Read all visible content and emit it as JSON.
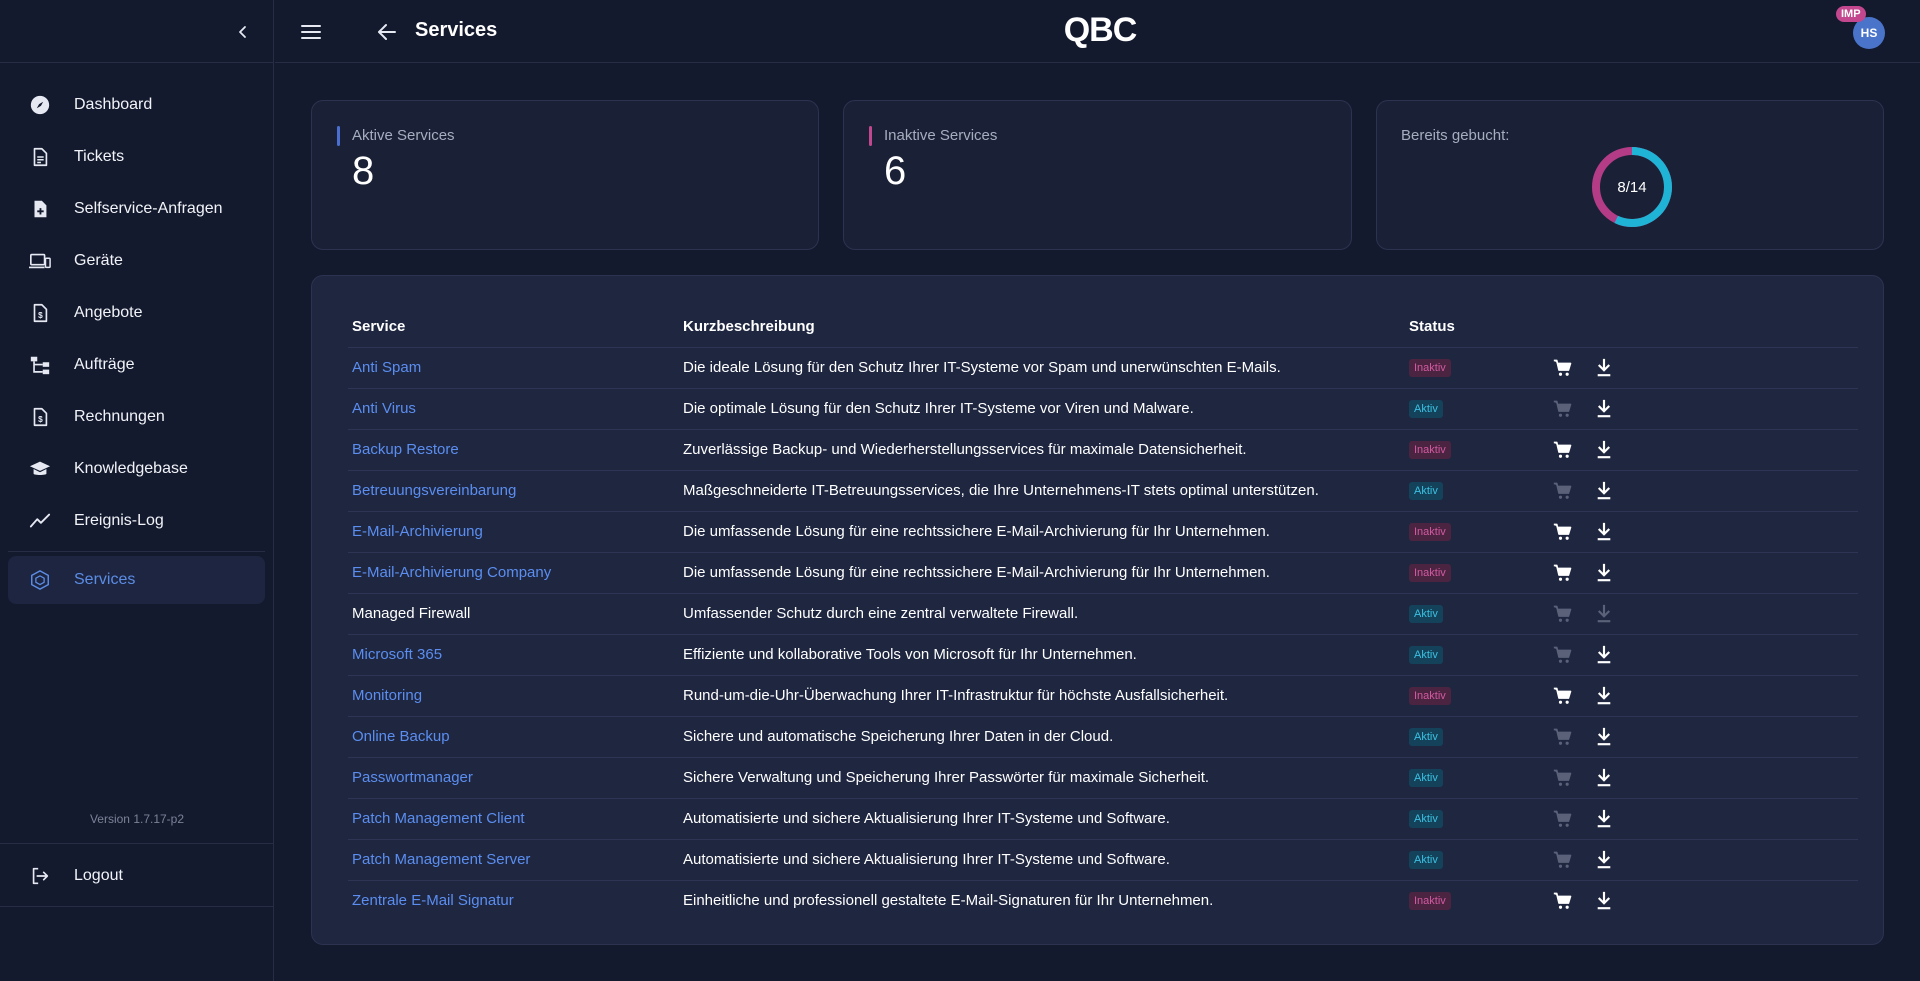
{
  "app": {
    "page_title": "Services",
    "logo_text": "QBC",
    "avatar_initials": "HS",
    "imp_badge": "IMP"
  },
  "sidebar": {
    "items": [
      {
        "id": "dashboard",
        "label": "Dashboard",
        "icon": "compass-icon"
      },
      {
        "id": "tickets",
        "label": "Tickets",
        "icon": "document-icon"
      },
      {
        "id": "selfservice",
        "label": "Selfservice-Anfragen",
        "icon": "file-plus-icon"
      },
      {
        "id": "geraete",
        "label": "Geräte",
        "icon": "devices-icon"
      },
      {
        "id": "angebote",
        "label": "Angebote",
        "icon": "invoice-icon"
      },
      {
        "id": "auftraege",
        "label": "Aufträge",
        "icon": "sitemap-icon"
      },
      {
        "id": "rechnungen",
        "label": "Rechnungen",
        "icon": "invoice-icon"
      },
      {
        "id": "knowledgebase",
        "label": "Knowledgebase",
        "icon": "graduation-cap-icon"
      },
      {
        "id": "ereignis",
        "label": "Ereignis-Log",
        "icon": "chart-line-icon"
      }
    ],
    "active": {
      "id": "services",
      "label": "Services",
      "icon": "cube-icon"
    },
    "version": "Version 1.7.17-p2",
    "logout": "Logout"
  },
  "stats": {
    "active_label": "Aktive Services",
    "active_value": "8",
    "inactive_label": "Inaktive Services",
    "inactive_value": "6",
    "booked_label": "Bereits gebucht:",
    "booked_text": "8/14",
    "booked_fraction": 0.5714
  },
  "table": {
    "headers": {
      "service": "Service",
      "description": "Kurzbeschreibung",
      "status": "Status"
    },
    "rows": [
      {
        "name": "Anti Spam",
        "description": "Die ideale Lösung für den Schutz Ihrer IT-Systeme vor Spam und unerwünschten E-Mails.",
        "status": "Inaktiv",
        "link": true,
        "cart": true,
        "download": true
      },
      {
        "name": "Anti Virus",
        "description": "Die optimale Lösung für den Schutz Ihrer IT-Systeme vor Viren und Malware.",
        "status": "Aktiv",
        "link": true,
        "cart": false,
        "download": true
      },
      {
        "name": "Backup Restore",
        "description": "Zuverlässige Backup- und Wiederherstellungsservices für maximale Datensicherheit.",
        "status": "Inaktiv",
        "link": true,
        "cart": true,
        "download": true
      },
      {
        "name": "Betreuungsvereinbarung",
        "description": "Maßgeschneiderte IT-Betreuungsservices, die Ihre Unternehmens-IT stets optimal unterstützen.",
        "status": "Aktiv",
        "link": true,
        "cart": false,
        "download": true
      },
      {
        "name": "E-Mail-Archivierung",
        "description": "Die umfassende Lösung für eine rechtssichere E-Mail-Archivierung für Ihr Unternehmen.",
        "status": "Inaktiv",
        "link": true,
        "cart": true,
        "download": true
      },
      {
        "name": "E-Mail-Archivierung Company",
        "description": "Die umfassende Lösung für eine rechtssichere E-Mail-Archivierung für Ihr Unternehmen.",
        "status": "Inaktiv",
        "link": true,
        "cart": true,
        "download": true
      },
      {
        "name": "Managed Firewall",
        "description": "Umfassender Schutz durch eine zentral verwaltete Firewall.",
        "status": "Aktiv",
        "link": false,
        "cart": false,
        "download": false
      },
      {
        "name": "Microsoft 365",
        "description": "Effiziente und kollaborative Tools von Microsoft für Ihr Unternehmen.",
        "status": "Aktiv",
        "link": true,
        "cart": false,
        "download": true
      },
      {
        "name": "Monitoring",
        "description": "Rund-um-die-Uhr-Überwachung Ihrer IT-Infrastruktur für höchste Ausfallsicherheit.",
        "status": "Inaktiv",
        "link": true,
        "cart": true,
        "download": true
      },
      {
        "name": "Online Backup",
        "description": "Sichere und automatische Speicherung Ihrer Daten in der Cloud.",
        "status": "Aktiv",
        "link": true,
        "cart": false,
        "download": true
      },
      {
        "name": "Passwortmanager",
        "description": "Sichere Verwaltung und Speicherung Ihrer Passwörter für maximale Sicherheit.",
        "status": "Aktiv",
        "link": true,
        "cart": false,
        "download": true
      },
      {
        "name": "Patch Management Client",
        "description": "Automatisierte und sichere Aktualisierung Ihrer IT-Systeme und Software.",
        "status": "Aktiv",
        "link": true,
        "cart": false,
        "download": true
      },
      {
        "name": "Patch Management Server",
        "description": "Automatisierte und sichere Aktualisierung Ihrer IT-Systeme und Software.",
        "status": "Aktiv",
        "link": true,
        "cart": false,
        "download": true
      },
      {
        "name": "Zentrale E-Mail Signatur",
        "description": "Einheitliche und professionell gestaltete E-Mail-Signaturen für Ihr Unternehmen.",
        "status": "Inaktiv",
        "link": true,
        "cart": true,
        "download": true
      }
    ]
  },
  "colors": {
    "background": "#141a2e",
    "card": "#1a2136",
    "accent_blue": "#5b8ef0",
    "active_bar": "#4a6fd1",
    "inactive_bar": "#c2478e",
    "donut_booked": "#1fb3d6",
    "donut_rest": "#b43c87"
  }
}
